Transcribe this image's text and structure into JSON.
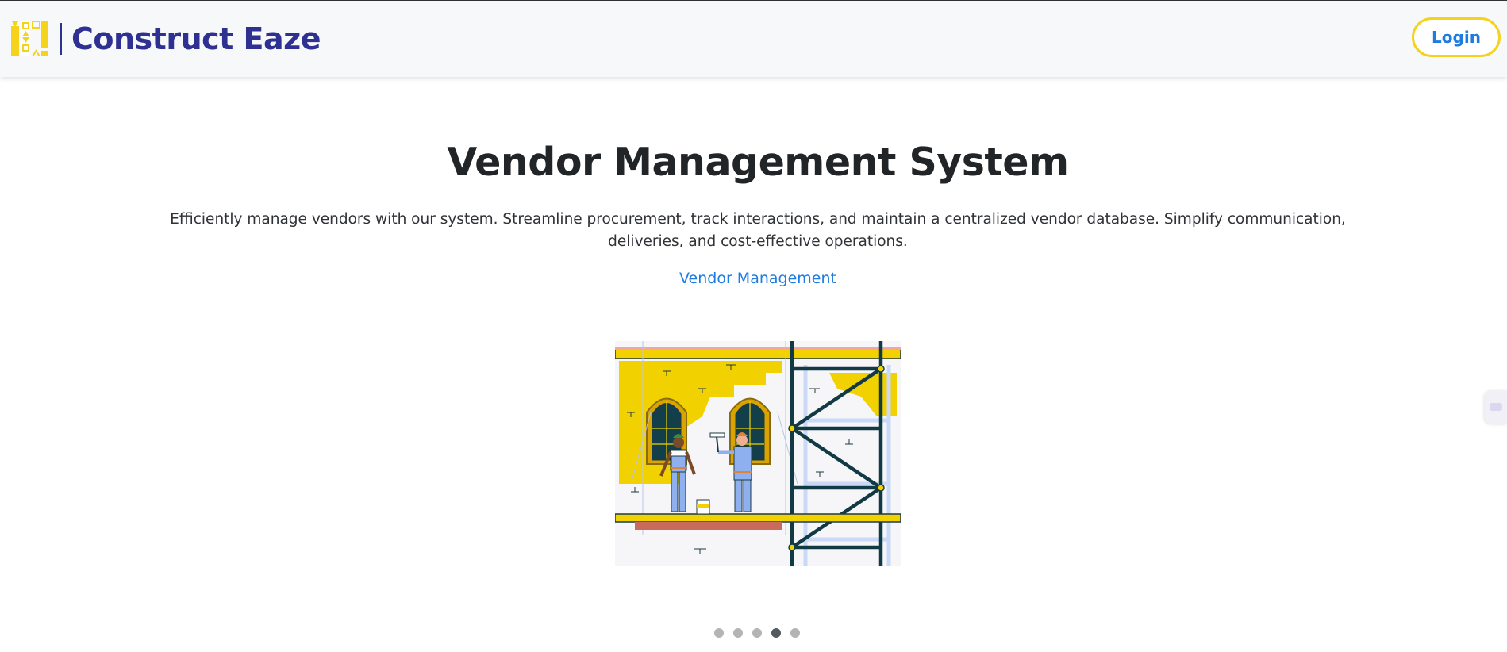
{
  "header": {
    "brand_name": "Construct Eaze",
    "login_label": "Login",
    "brand_color": "#2e3192",
    "accent_yellow": "#f5d21c"
  },
  "hero": {
    "title": "Vendor Management System",
    "description": "Efficiently manage vendors with our system. Streamline procurement, track interactions, and maintain a centralized vendor database. Simplify communication, deliveries, and cost-effective operations.",
    "link_label": "Vendor Management",
    "link_color": "#1e7be0",
    "illustration": "workers-painting-building-scaffold"
  },
  "carousel": {
    "dot_count": 5,
    "active_index": 3
  },
  "icons": {
    "logo": "construct-eaze-logo-icon",
    "side_tab": "widget-tab-icon"
  }
}
